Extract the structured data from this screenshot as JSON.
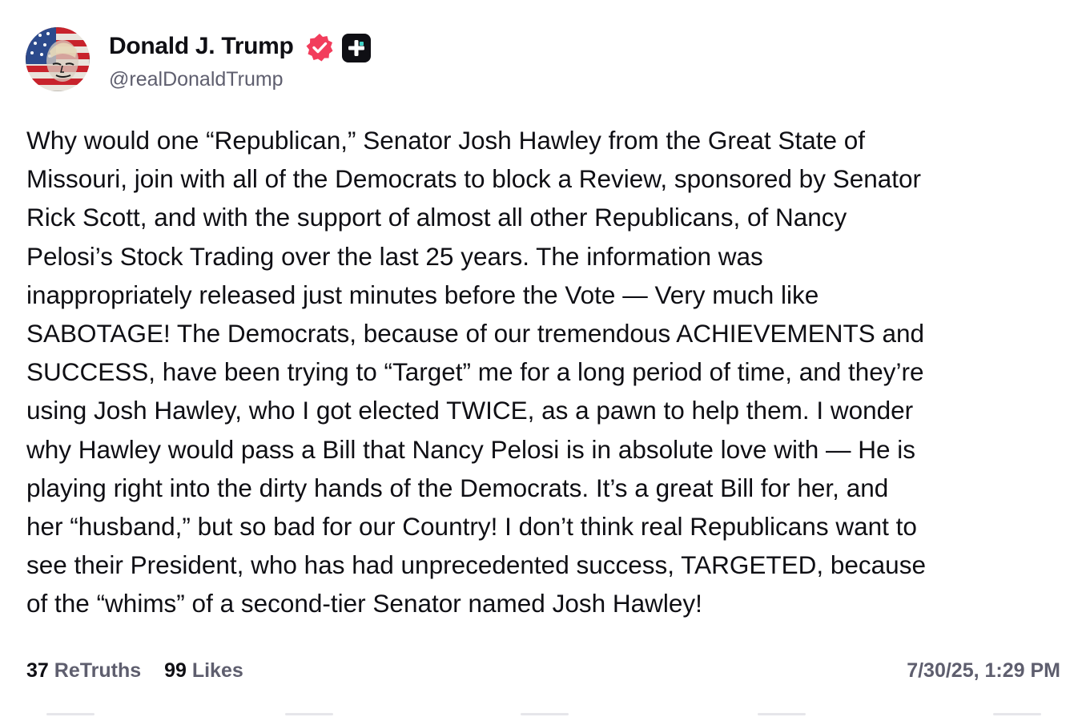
{
  "author": {
    "display_name": "Donald J. Trump",
    "handle": "@realDonaldTrump",
    "avatar": "avatar-flag-portrait",
    "verified_icon": "verified-badge-icon",
    "verified_color": "#f23d5c",
    "plus_icon": "truth-plus-icon"
  },
  "post": {
    "lines": [
      "Why would one “Republican,” Senator Josh Hawley from the Great State of",
      "Missouri, join with all of the Democrats to block a Review, sponsored by Senator",
      "Rick Scott, and with the support of almost all other Republicans, of Nancy",
      "Pelosi’s Stock Trading over the last 25 years. The information was",
      "inappropriately released just minutes before the Vote — Very much like",
      "SABOTAGE! The Democrats, because of our tremendous ACHIEVEMENTS and",
      "SUCCESS, have been trying to “Target” me for a long period of time, and they’re",
      "using Josh Hawley, who I got elected TWICE, as a pawn to help them. I wonder",
      "why Hawley would pass a Bill that Nancy Pelosi is in absolute love with — He is",
      "playing right into the dirty hands of the Democrats. It’s a great Bill for her, and",
      "her “husband,” but so bad for our Country! I don’t think real Republicans want to",
      "see their President, who has had unprecedented success, TARGETED, because",
      "of the “whims” of a second-tier Senator named Josh Hawley!"
    ]
  },
  "stats": {
    "retruths_count": "37",
    "retruths_label": "ReTruths",
    "likes_count": "99",
    "likes_label": "Likes"
  },
  "timestamp": "7/30/25, 1:29 PM"
}
